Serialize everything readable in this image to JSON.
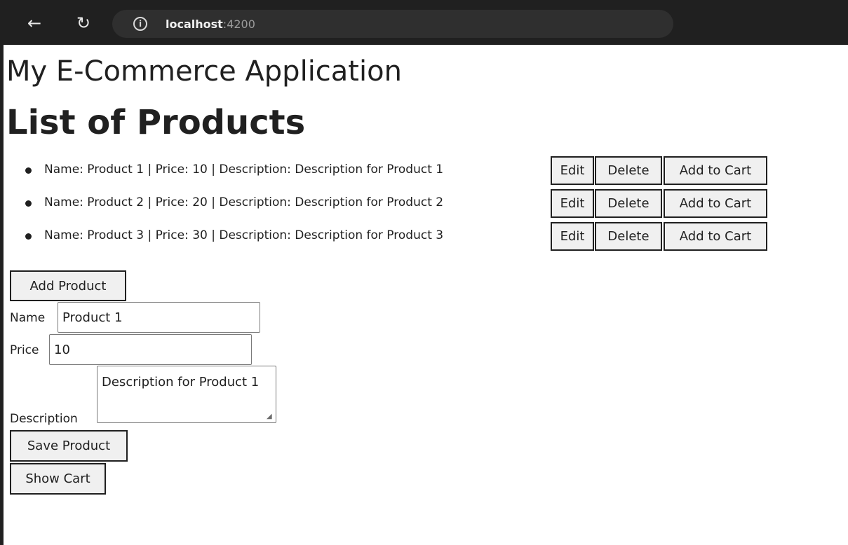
{
  "browser": {
    "back_icon": "arrow-left-icon",
    "reload_icon": "reload-icon",
    "info_icon": "info-circle-icon",
    "url_host": "localhost",
    "url_port": ":4200"
  },
  "page": {
    "app_title": "My E-Commerce Application",
    "list_title": "List of Products",
    "products": [
      {
        "text": "Name: Product 1 | Price: 10 | Description: Description for Product 1",
        "edit_label": "Edit",
        "delete_label": "Delete",
        "cart_label": "Add to Cart"
      },
      {
        "text": "Name: Product 2 | Price: 20 | Description: Description for Product 2",
        "edit_label": "Edit",
        "delete_label": "Delete",
        "cart_label": "Add to Cart"
      },
      {
        "text": "Name: Product 3 | Price: 30 | Description: Description for Product 3",
        "edit_label": "Edit",
        "delete_label": "Delete",
        "cart_label": "Add to Cart"
      }
    ],
    "add_product_label": "Add Product",
    "form": {
      "name_label": "Name",
      "name_value": "Product 1",
      "price_label": "Price",
      "price_value": "10",
      "description_label": "Description",
      "description_value": "Description for Product 1"
    },
    "save_product_label": "Save Product",
    "show_cart_label": "Show Cart"
  }
}
